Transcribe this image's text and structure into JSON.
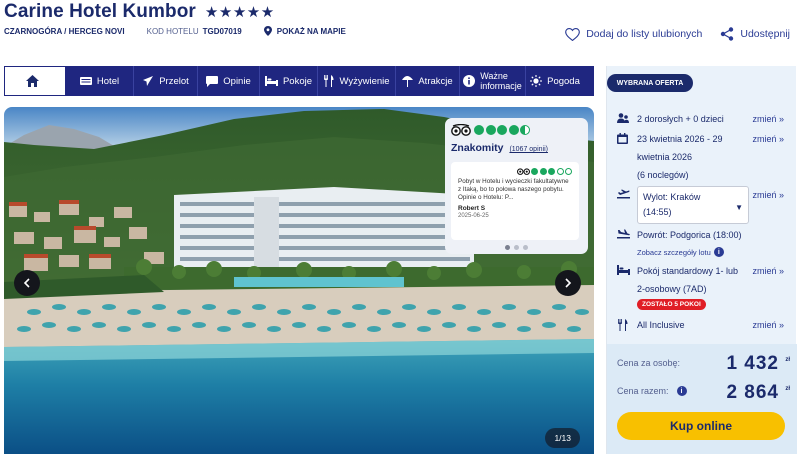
{
  "hotel": {
    "name": "Carine Hotel Kumbor",
    "stars": "★★★★★",
    "location": "CZARNOGÓRA / HERCEG NOVI",
    "code_label": "KOD HOTELU",
    "code_value": "TGD07019",
    "map_label": "POKAŻ NA MAPIE"
  },
  "actions": {
    "favorite": "Dodaj do listy ulubionych",
    "share": "Udostępnij"
  },
  "tabs": [
    {
      "label": "Hotel",
      "icon": "hotel-icon"
    },
    {
      "label": "Przelot",
      "icon": "plane-icon"
    },
    {
      "label": "Opinie",
      "icon": "chat-icon"
    },
    {
      "label": "Pokoje",
      "icon": "bed-icon"
    },
    {
      "label": "Wyżywienie",
      "icon": "cutlery-icon"
    },
    {
      "label": "Atrakcje",
      "icon": "beach-icon"
    },
    {
      "label_line1": "Ważne",
      "label_line2": "informacje",
      "icon": "info-icon"
    },
    {
      "label": "Pogoda",
      "icon": "sun-icon"
    }
  ],
  "gallery": {
    "counter": "1/13"
  },
  "review": {
    "rating_dots": 4.5,
    "rating_label": "Znakomity",
    "count": "(1067 opinii)",
    "card_dots": 3,
    "text": "Pobyt w Hotelu i wycieczki fakultatywne z Itaką, bo to połowa naszego pobytu. Opinie o Hotelu: P...",
    "author": "Robert S",
    "date": "2025-06-25"
  },
  "offer": {
    "header": "WYBRANA OFERTA",
    "change_label": "zmień »",
    "guests": "2 dorosłych + 0 dzieci",
    "dates_line1": "23 kwietnia 2026 - 29",
    "dates_line2": "kwietnia 2026",
    "dates_line3": "(6 noclegów)",
    "departure_line1": "Wylot: Kraków",
    "departure_line2": "(14:55)",
    "return": "Powrót: Podgorica (18:00)",
    "flight_details": "Zobacz szczegóły lotu",
    "room_line1": "Pokój standardowy 1- lub",
    "room_line2": "2-osobowy (7AD)",
    "rooms_left": "ZOSTAŁO 5 POKOI",
    "board": "All Inclusive",
    "price_per_person_label": "Cena za osobę:",
    "price_per_person": "1 432",
    "price_total_label": "Cena razem:",
    "price_total": "2 864",
    "currency": "zł",
    "buy_label": "Kup online"
  },
  "colors": {
    "navy": "#1b2a6b",
    "tab_bg": "#1f2680",
    "buy": "#f8c000",
    "rating": "#1aa75e",
    "alert": "#e01e26"
  }
}
